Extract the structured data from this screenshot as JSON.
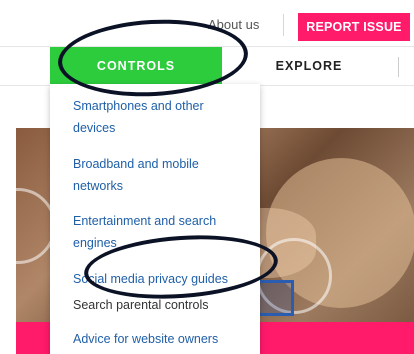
{
  "header": {
    "about_label": "About us",
    "report_label": "REPORT ISSUE",
    "report_color": "#ff1a6a"
  },
  "nav": {
    "tabs": [
      {
        "label": "CONTROLS",
        "active": true,
        "color": "#2ccc3c"
      },
      {
        "label": "EXPLORE",
        "active": false
      }
    ]
  },
  "dropdown": {
    "items": [
      {
        "label": "Smartphones and other devices"
      },
      {
        "label": "Broadband and mobile networks"
      },
      {
        "label": "Entertainment and search engines"
      },
      {
        "label": "Social media privacy guides"
      },
      {
        "label": "Search parental controls"
      },
      {
        "label": "Advice for website owners"
      }
    ]
  },
  "colors": {
    "link": "#1f5fa8",
    "annotation": "#0b1225"
  }
}
